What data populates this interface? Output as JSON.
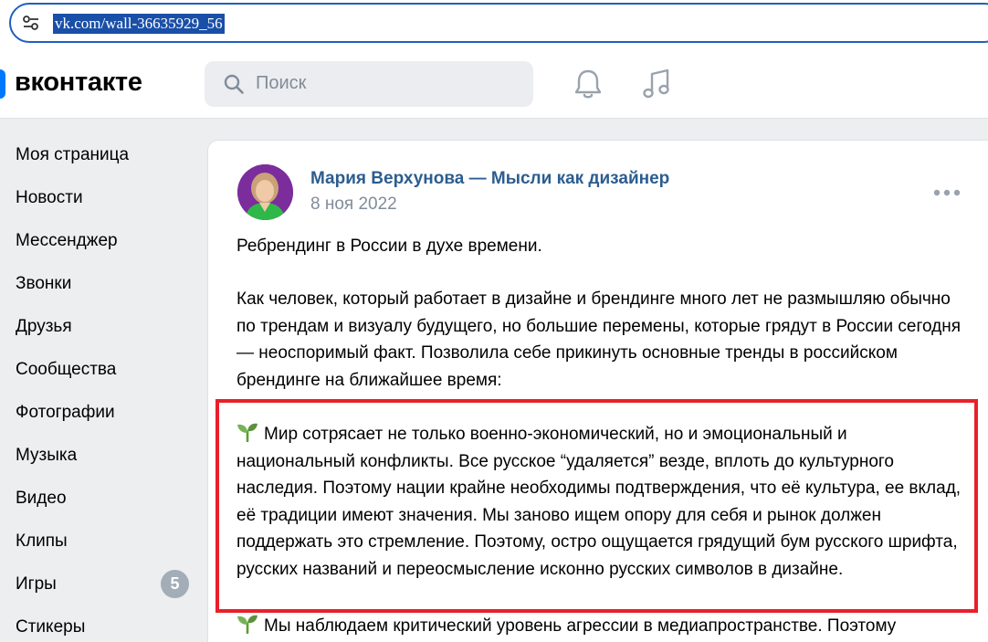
{
  "browser": {
    "url": "vk.com/wall-36635929_56"
  },
  "header": {
    "logo_text": "вконтакте",
    "search_placeholder": "Поиск",
    "icons": [
      "bell-icon",
      "music-icon"
    ]
  },
  "sidebar": {
    "items": [
      {
        "label": "Моя страница"
      },
      {
        "label": "Новости"
      },
      {
        "label": "Мессенджер"
      },
      {
        "label": "Звонки"
      },
      {
        "label": "Друзья"
      },
      {
        "label": "Сообщества"
      },
      {
        "label": "Фотографии"
      },
      {
        "label": "Музыка"
      },
      {
        "label": "Видео"
      },
      {
        "label": "Клипы"
      },
      {
        "label": "Игры",
        "badge": "5"
      },
      {
        "label": "Стикеры"
      }
    ]
  },
  "post": {
    "author": "Мария Верхунова — Мысли как дизайнер",
    "date": "8 ноя 2022",
    "paragraph1": "Ребрендинг в России в духе времени.",
    "paragraph2": "Как человек, который работает в дизайне и брендинге много лет не размышляю обычно по трендам и визуалу будущего, но большие перемены, которые грядут в России сегодня — неоспоримый факт. Позволила себе прикинуть основные тренды в российском брендинге на ближайшее время:",
    "paragraph3": "Мир сотрясает не только военно-экономический, но и эмоциональный и национальный конфликты. Все русское “удаляется” везде, вплоть до культурного наследия. Поэтому нации крайне необходимы подтверждения, что её культура, ее вклад, её традиции имеют значения. Мы заново ищем опору для себя и рынок должен поддержать это стремление. Поэтому, остро ощущается грядущий бум русского шрифта, русских названий и переосмысление исконно русских символов в дизайне.",
    "paragraph4": "Мы наблюдаем критический уровень агрессии в медиапространстве. Поэтому"
  },
  "colors": {
    "accent": "#0077ff",
    "author_link": "#2c5d8f",
    "highlight_border": "#e8202a",
    "badge": "#a3adb8"
  }
}
